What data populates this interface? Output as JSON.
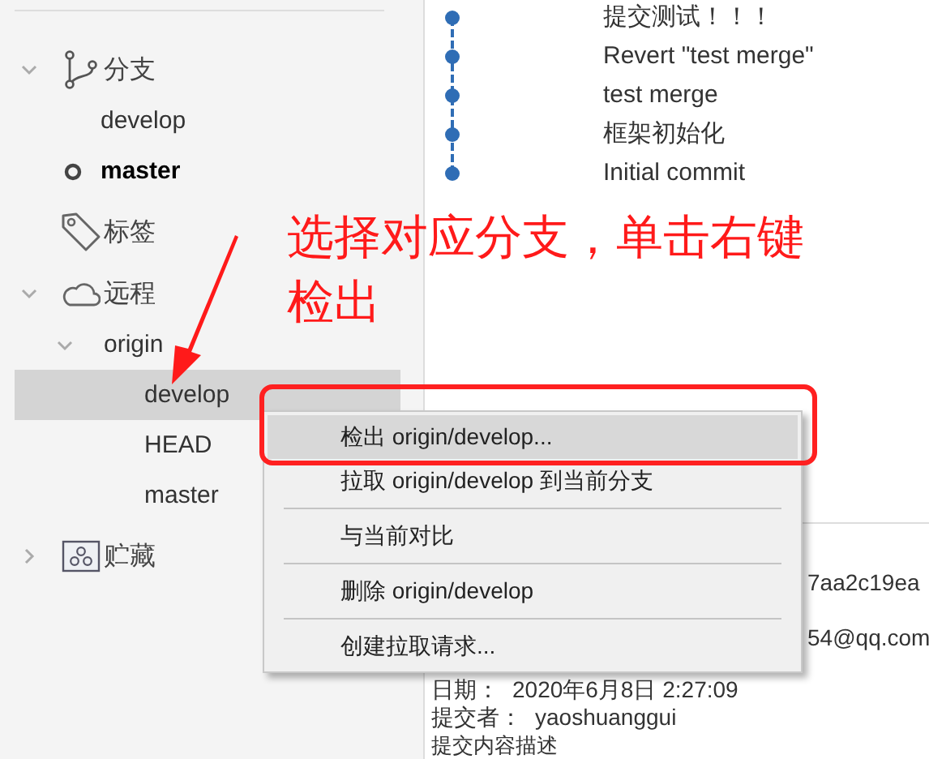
{
  "sidebar": {
    "sections": [
      {
        "label": "分支",
        "expanded": true,
        "children": [
          {
            "label": "develop",
            "current": false
          },
          {
            "label": "master",
            "current": true
          }
        ]
      },
      {
        "label": "标签"
      },
      {
        "label": "远程",
        "expanded": true,
        "remotes": [
          {
            "label": "origin",
            "expanded": true,
            "children": [
              {
                "label": "develop",
                "selected": true
              },
              {
                "label": "HEAD",
                "selected": false
              },
              {
                "label": "master",
                "selected": false
              }
            ]
          }
        ]
      },
      {
        "label": "贮藏",
        "expanded": false
      }
    ]
  },
  "commits": [
    "提交测试！！！",
    "Revert \"test merge\"",
    "test merge",
    "框架初始化",
    "Initial commit"
  ],
  "annotation": {
    "lines": [
      "选择对应分支，单击右键",
      "检出"
    ]
  },
  "context_menu": {
    "items": [
      {
        "label": "检出 origin/develop...",
        "selected": true,
        "separator_before": false
      },
      {
        "label": "拉取 origin/develop 到当前分支",
        "selected": false,
        "separator_before": false
      },
      {
        "label": "与当前对比",
        "selected": false,
        "separator_before": true
      },
      {
        "label": "删除 origin/develop",
        "selected": false,
        "separator_before": true
      },
      {
        "label": "创建拉取请求...",
        "selected": false,
        "separator_before": true
      }
    ]
  },
  "details": {
    "hash": "7aa2c19ea",
    "email": "54@qq.com",
    "date_label": "日期：",
    "date": "2020年6月8日 2:27:09",
    "committer_label": "提交者：",
    "committer": "yaoshuanggui",
    "description": "提交内容描述"
  }
}
